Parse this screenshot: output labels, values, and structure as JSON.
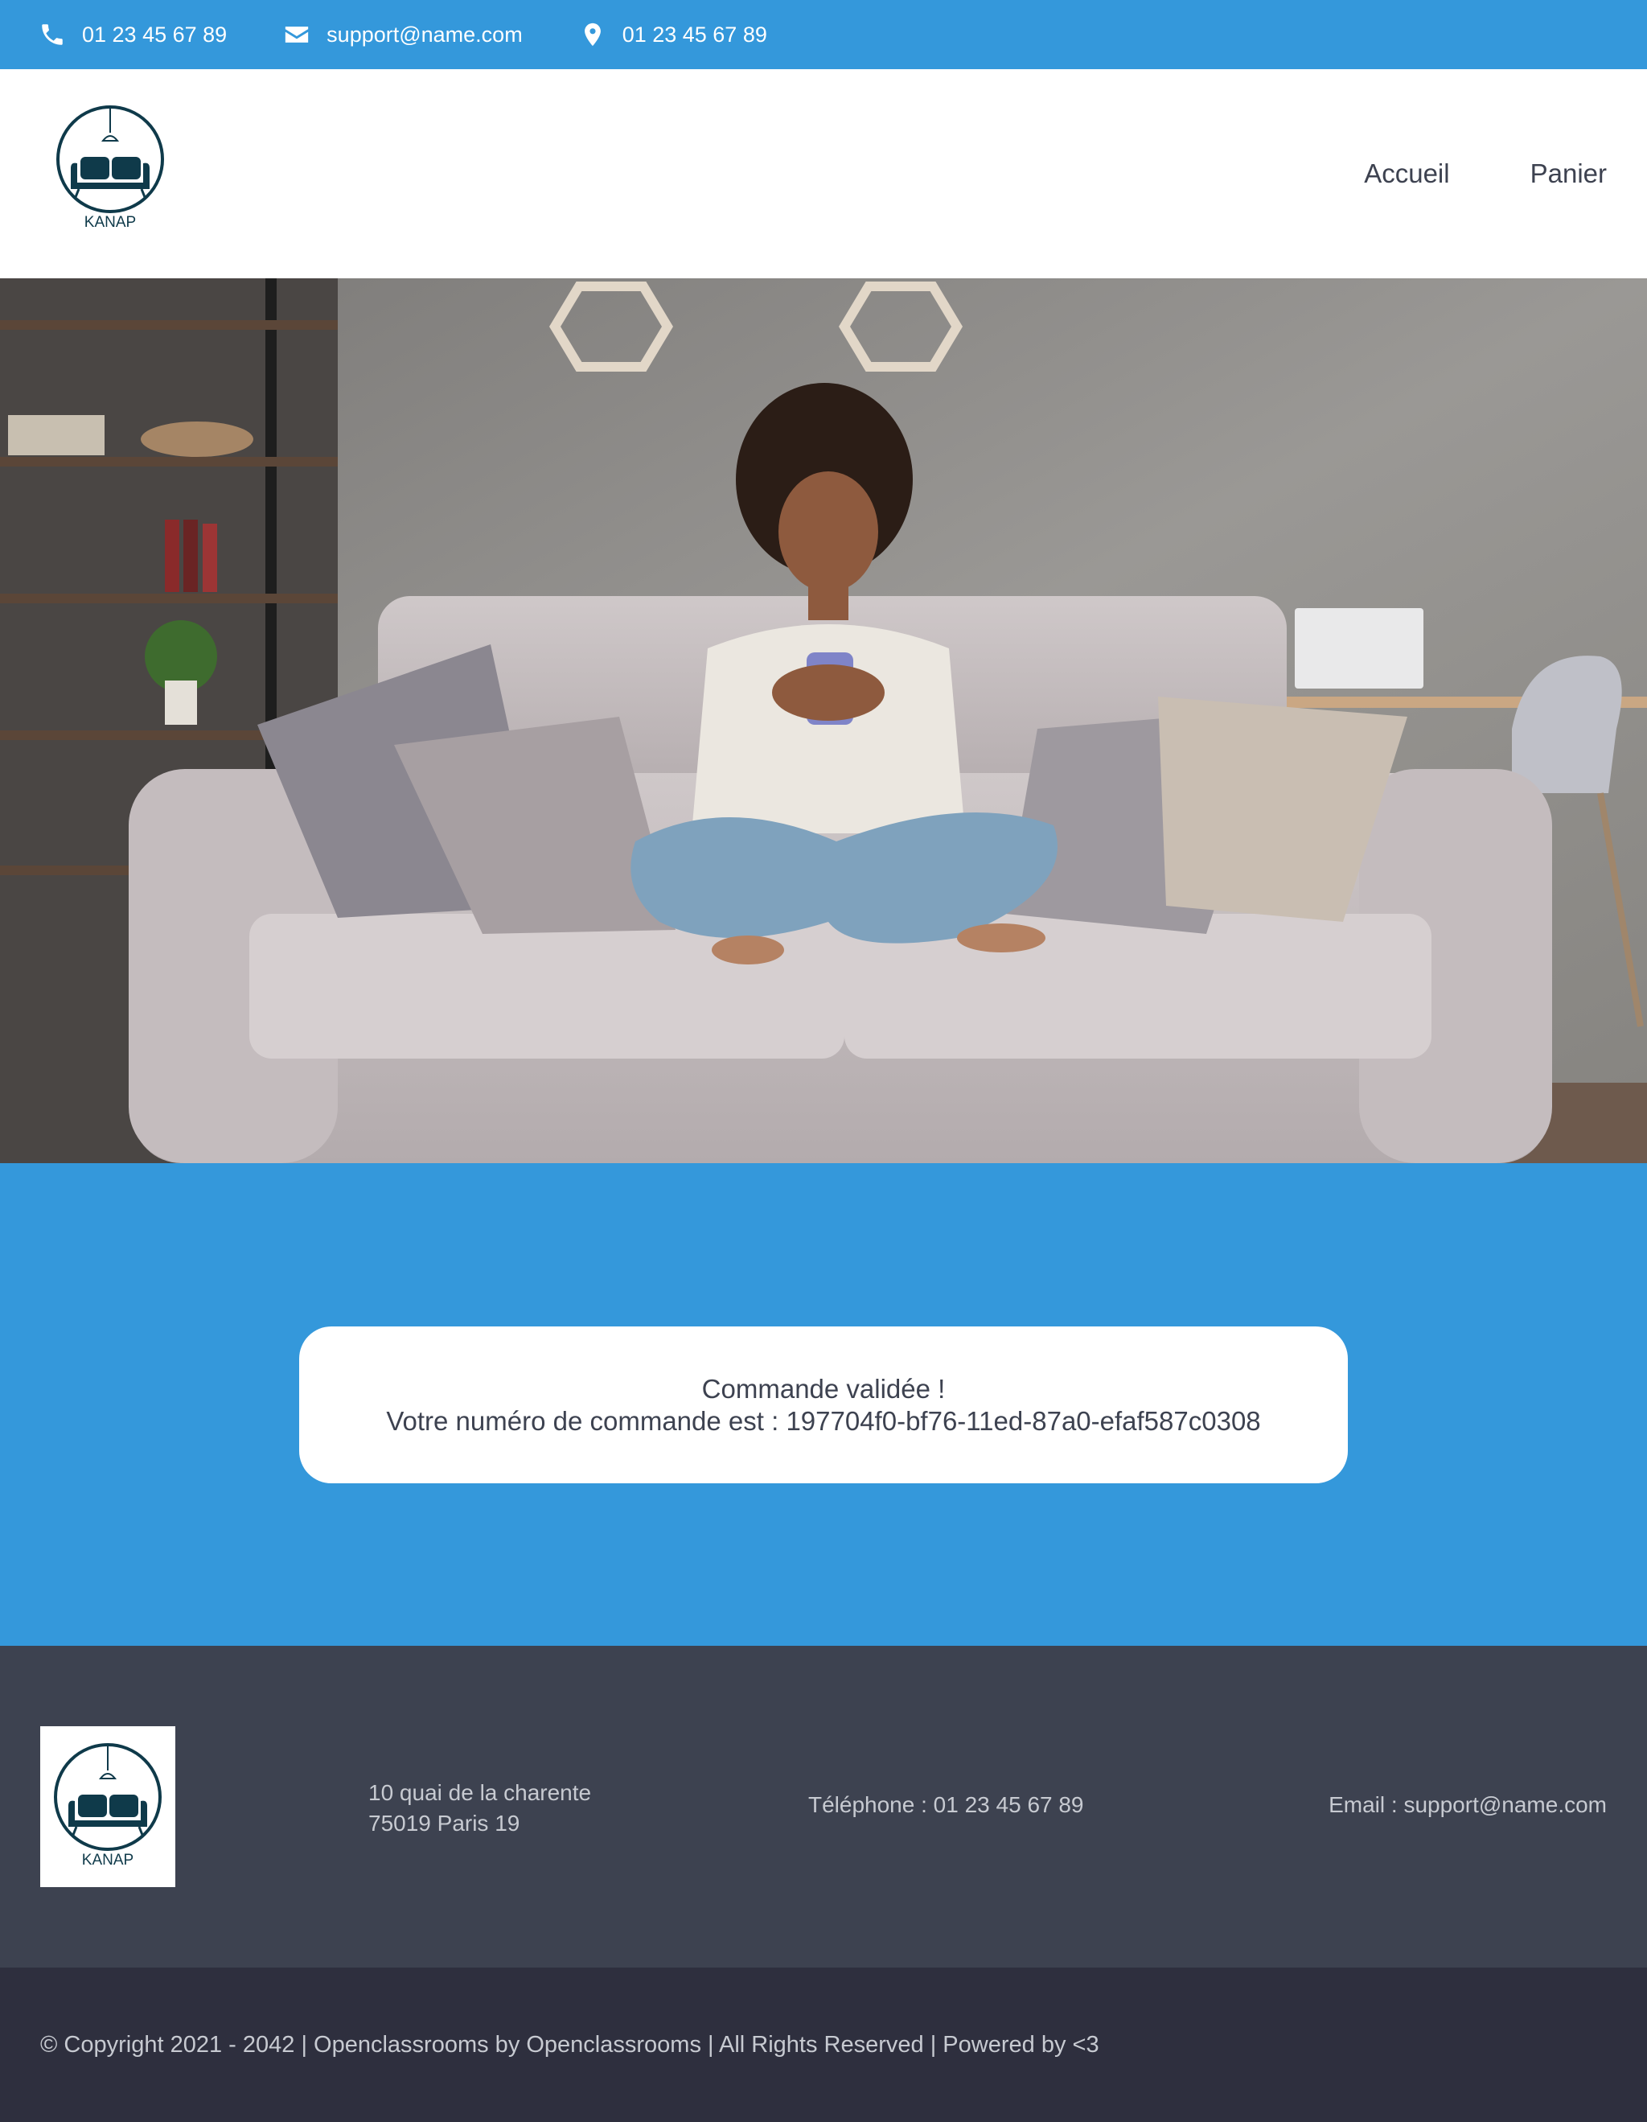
{
  "topbar": {
    "phone": "01 23 45 67 89",
    "email": "support@name.com",
    "location": "01 23 45 67 89"
  },
  "header": {
    "logo_text": "KANAP",
    "nav": {
      "home": "Accueil",
      "cart": "Panier"
    }
  },
  "confirmation": {
    "title": "Commande validée !",
    "order_prefix": "Votre numéro de commande est : ",
    "order_id": "197704f0-bf76-11ed-87a0-efaf587c0308"
  },
  "footer": {
    "logo_text": "KANAP",
    "address_line1": "10 quai de la charente",
    "address_line2": "75019 Paris 19",
    "telephone": "Téléphone : 01 23 45 67 89",
    "email": "Email : support@name.com"
  },
  "copyright": "© Copyright 2021 - 2042 | Openclassrooms by Openclassrooms | All Rights Reserved | Powered by <3",
  "colors": {
    "primary": "#3498db",
    "footer": "#3d4250",
    "copyright_bg": "#2e2f3e",
    "logo": "#0f3a4a"
  },
  "icons": [
    "phone-icon",
    "envelope-icon",
    "map-pin-icon"
  ]
}
